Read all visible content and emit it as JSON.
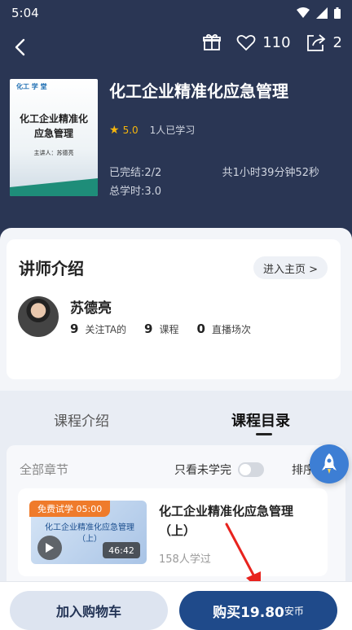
{
  "status_bar": {
    "time": "5:04"
  },
  "nav": {
    "likes": "110",
    "shares": "2"
  },
  "course": {
    "cover_logo": "化工 学 堂",
    "cover_title_line1": "化工企业精准化",
    "cover_title_line2": "应急管理",
    "cover_lecturer": "主讲人：苏德亮",
    "title": "化工企业精准化应急管理",
    "rating": "5.0",
    "learners": "1人已学习",
    "progress": "已完结:2/2",
    "total_time": "共1小时39分钟52秒",
    "total_hours": "总学时:3.0"
  },
  "teacher": {
    "heading": "讲师介绍",
    "homepage_label": "进入主页 >",
    "name": "苏德亮",
    "followers_num": "9",
    "followers_label": "关注TA的",
    "courses_num": "9",
    "courses_label": "课程",
    "live_num": "0",
    "live_label": "直播场次"
  },
  "tabs": {
    "intro": "课程介绍",
    "catalog": "课程目录"
  },
  "catalog": {
    "all_chapters": "全部章节",
    "only_unlearned": "只看未学完",
    "sort": "排序"
  },
  "lesson": {
    "trial_badge": "免费试学 05:00",
    "thumb_title": "化工企业精准化应急管理（上）",
    "duration": "46:42",
    "title": "化工企业精准化应急管理（上）",
    "learners": "158人学过"
  },
  "bottom": {
    "cart_label": "加入购物车",
    "buy_label": "购买19.80",
    "buy_unit": "安币"
  },
  "colors": {
    "header_bg": "#2a3654",
    "primary": "#1f4a8a",
    "star": "#f5b50d",
    "trial_badge": "#ef7b2b",
    "annotation_arrow": "#e8231e"
  }
}
